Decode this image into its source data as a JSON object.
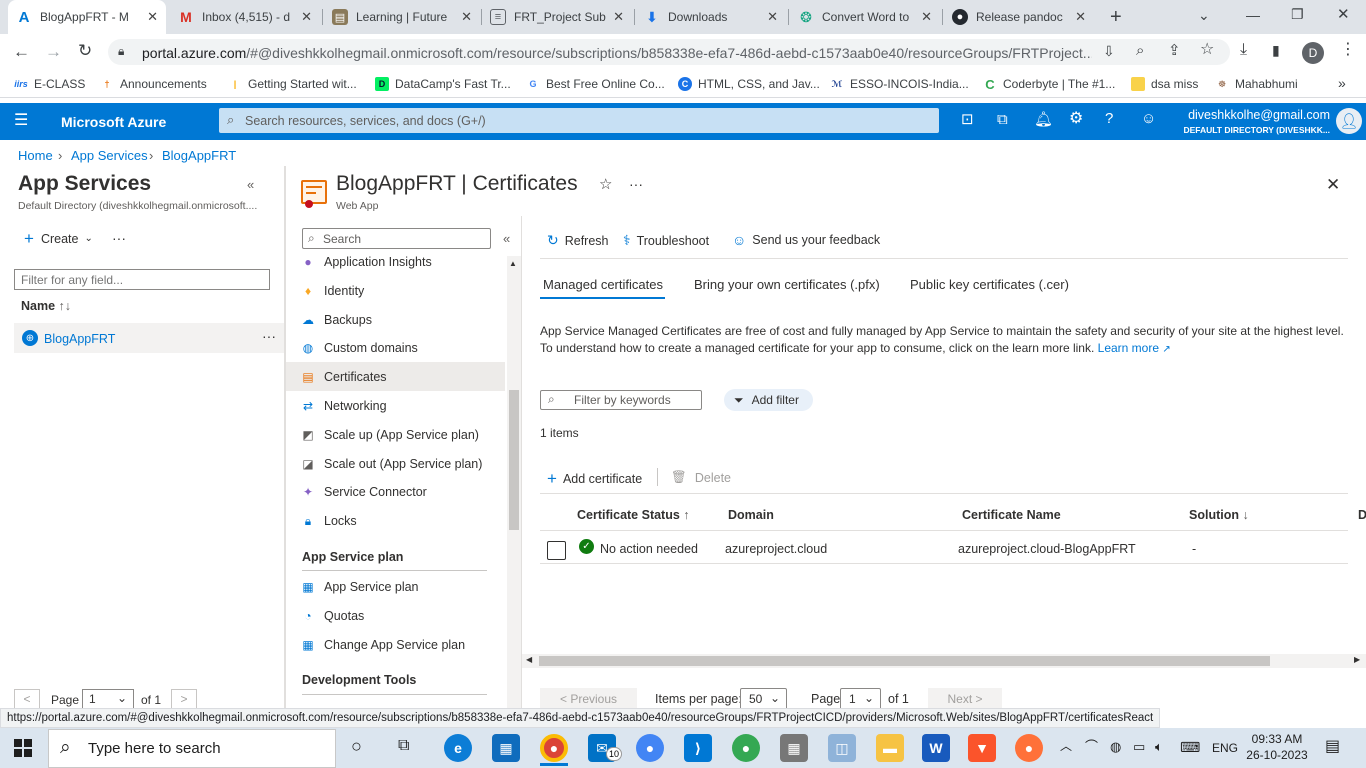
{
  "browser": {
    "tabs": [
      {
        "title": "BlogAppFRT - M",
        "favicon": "azure-icon"
      },
      {
        "title": "Inbox (4,515) - d",
        "favicon": "gmail-icon"
      },
      {
        "title": "Learning | Future",
        "favicon": "learning-icon"
      },
      {
        "title": "FRT_Project Sub",
        "favicon": "document-icon"
      },
      {
        "title": "Downloads",
        "favicon": "download-icon"
      },
      {
        "title": "Convert Word to",
        "favicon": "chatgpt-icon"
      },
      {
        "title": "Release pandoc",
        "favicon": "github-icon"
      }
    ],
    "url_host": "portal.azure.com",
    "url_path": "/#@diveshkkolhegmail.onmicrosoft.com/resource/subscriptions/b858338e-efa7-486d-aebd-c1573aab0e40/resourceGroups/FRTProject...",
    "profile_initial": "D",
    "bookmarks": [
      "E-CLASS",
      "Announcements",
      "Getting Started wit...",
      "DataCamp's Fast Tr...",
      "Best Free Online Co...",
      "HTML, CSS, and Jav...",
      "ESSO-INCOIS-India...",
      "Coderbyte | The #1...",
      "dsa miss",
      "Mahabhumi"
    ],
    "status_url": "https://portal.azure.com/#@diveshkkolhegmail.onmicrosoft.com/resource/subscriptions/b858338e-efa7-486d-aebd-c1573aab0e40/resourceGroups/FRTProjectCICD/providers/Microsoft.Web/sites/BlogAppFRT/certificatesReact"
  },
  "azure": {
    "brand": "Microsoft Azure",
    "search_placeholder": "Search resources, services, and docs (G+/)",
    "user_email": "diveshkkolhe@gmail.com",
    "user_directory": "DEFAULT DIRECTORY (DIVESHKK...",
    "accent": "#0078d4"
  },
  "breadcrumb": [
    "Home",
    "App Services",
    "BlogAppFRT"
  ],
  "left_blade": {
    "title": "App Services",
    "subtitle": "Default Directory (diveshkkolhegmail.onmicrosoft....",
    "create_label": "Create",
    "filter_placeholder": "Filter for any field...",
    "name_header": "Name",
    "items": [
      "BlogAppFRT"
    ],
    "pager": {
      "page_label": "Page",
      "page": "1",
      "of_label": "of 1"
    }
  },
  "resource": {
    "title": "BlogAppFRT | Certificates",
    "type": "Web App"
  },
  "menu": {
    "search_placeholder": "Search",
    "items": [
      "Application Insights",
      "Identity",
      "Backups",
      "Custom domains",
      "Certificates",
      "Networking",
      "Scale up (App Service plan)",
      "Scale out (App Service plan)",
      "Service Connector",
      "Locks"
    ],
    "section_plan": "App Service plan",
    "plan_items": [
      "App Service plan",
      "Quotas",
      "Change App Service plan"
    ],
    "section_dev": "Development Tools"
  },
  "toolbar": {
    "refresh": "Refresh",
    "troubleshoot": "Troubleshoot",
    "feedback": "Send us your feedback"
  },
  "tabs": [
    "Managed certificates",
    "Bring your own certificates (.pfx)",
    "Public key certificates (.cer)"
  ],
  "description": {
    "line1": "App Service Managed Certificates are free of cost and fully managed by App Service to maintain the safety and security of your site at the highest level.",
    "line2": "To understand how to create a managed certificate for your app to consume, click on the learn more link.",
    "learn_more": "Learn more"
  },
  "filter": {
    "placeholder": "Filter by keywords",
    "add_filter": "Add filter",
    "count": "1 items"
  },
  "actions": {
    "add": "Add certificate",
    "delete": "Delete"
  },
  "table": {
    "headers": [
      "Certificate Status",
      "Domain",
      "Certificate Name",
      "Solution",
      "D"
    ],
    "rows": [
      {
        "status": "No action needed",
        "domain": "azureproject.cloud",
        "name": "azureproject.cloud-BlogAppFRT",
        "solution": "-"
      }
    ]
  },
  "pagination": {
    "previous": "< Previous",
    "items_per_page_label": "Items per page:",
    "items_per_page": "50",
    "page_label": "Page",
    "page": "1",
    "of_label": "of 1",
    "next": "Next >"
  },
  "taskbar": {
    "search_placeholder": "Type here to search",
    "lang": "ENG",
    "time": "09:33 AM",
    "date": "26-10-2023",
    "mail_badge": "10"
  }
}
